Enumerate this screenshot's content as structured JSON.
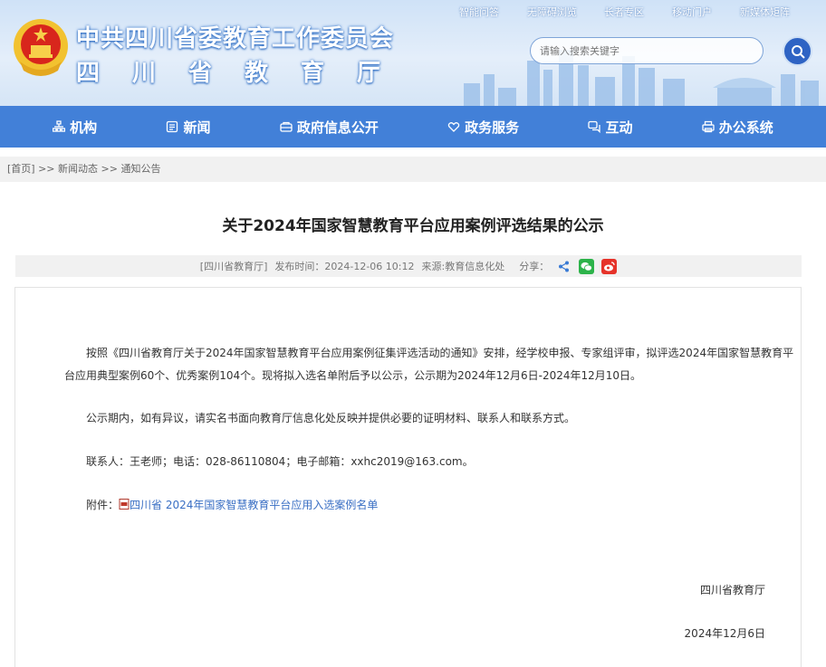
{
  "header": {
    "title_line1": "中共四川省委教育工作委员会",
    "title_line2": "四川省教育厅",
    "top_links": [
      "智能问答",
      "无障碍浏览",
      "长者专区",
      "移动门户",
      "新媒体矩阵"
    ],
    "search_placeholder": "请输入搜索关键字"
  },
  "nav": {
    "items": [
      {
        "label": "机构",
        "icon": "org-chart-icon"
      },
      {
        "label": "新闻",
        "icon": "news-icon"
      },
      {
        "label": "政府信息公开",
        "icon": "info-open-icon"
      },
      {
        "label": "政务服务",
        "icon": "service-icon"
      },
      {
        "label": "互动",
        "icon": "interact-icon"
      },
      {
        "label": "办公系统",
        "icon": "office-icon"
      }
    ]
  },
  "breadcrumb": {
    "home": "[首页]",
    "sep1": " >> ",
    "level1": "新闻动态",
    "sep2": " >> ",
    "level2": "通知公告"
  },
  "article": {
    "title": "关于2024年国家智慧教育平台应用案例评选结果的公示",
    "meta_org": "[四川省教育厅]",
    "meta_time": "发布时间：2024-12-06 10:12",
    "meta_source": "来源:教育信息化处",
    "meta_share": "分享：",
    "para1": "按照《四川省教育厅关于2024年国家智慧教育平台应用案例征集评选活动的通知》安排，经学校申报、专家组评审，拟评选2024年国家智慧教育平台应用典型案例60个、优秀案例104个。现将拟入选名单附后予以公示，公示期为2024年12月6日-2024年12月10日。",
    "para2": "公示期内，如有异议，请实名书面向教育厅信息化处反映并提供必要的证明材料、联系人和联系方式。",
    "para3": "联系人：王老师；电话：028-86110804；电子邮箱：xxhc2019@163.com。",
    "attach_label": "附件：",
    "attach_link": "四川省 2024年国家智慧教育平台应用入选案例名单",
    "sign_org": "四川省教育厅",
    "sign_date": "2024年12月6日"
  },
  "colors": {
    "nav_bg": "#4280d8",
    "link": "#3a6fc4",
    "search_btn": "#2e63c4",
    "wechat": "#2db34a",
    "weibo": "#e6332a"
  }
}
